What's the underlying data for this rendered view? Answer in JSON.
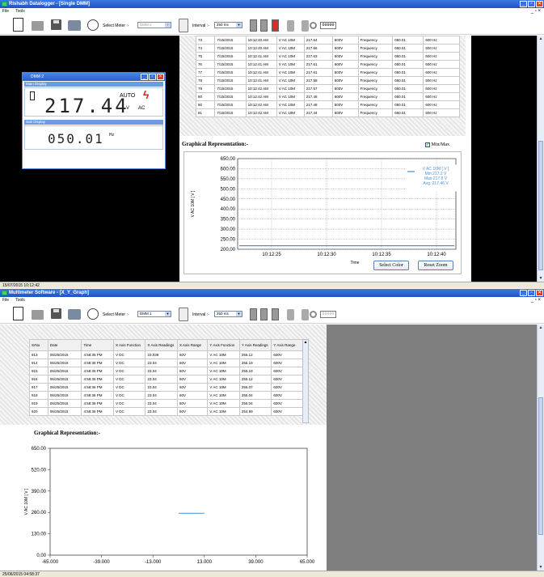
{
  "top": {
    "title": "Rishabh Datalogger - [Single DMM]",
    "menu": [
      "File",
      "Tools"
    ],
    "toolbar": {
      "select_meter_label": "Select Meter :-",
      "meter_value": "DMM 2",
      "interval_label": "Interval :-",
      "interval_value": "250 ms",
      "counter": "60000"
    },
    "table": {
      "rows": [
        [
          "73",
          "7/15/2015",
          "10:12:40 AM",
          "V AC 10M",
          "217.64",
          "600V",
          "Frequency",
          "050.01",
          "600 Hz"
        ],
        [
          "74",
          "7/15/2015",
          "10:12:40 AM",
          "V AC 10M",
          "217.66",
          "600V",
          "Frequency",
          "050.01",
          "600 Hz"
        ],
        [
          "75",
          "7/15/2015",
          "10:12:41 AM",
          "V AC 10M",
          "217.63",
          "600V",
          "Frequency",
          "050.01",
          "600 Hz"
        ],
        [
          "76",
          "7/15/2015",
          "10:12:41 AM",
          "V AC 10M",
          "217.61",
          "600V",
          "Frequency",
          "050.01",
          "600 Hz"
        ],
        [
          "77",
          "7/15/2015",
          "10:12:41 AM",
          "V AC 10M",
          "217.61",
          "600V",
          "Frequency",
          "050.01",
          "600 Hz"
        ],
        [
          "78",
          "7/15/2015",
          "10:12:41 AM",
          "V AC 10M",
          "217.58",
          "600V",
          "Frequency",
          "050.01",
          "600 Hz"
        ],
        [
          "79",
          "7/15/2015",
          "10:12:42 AM",
          "V AC 10M",
          "217.57",
          "600V",
          "Frequency",
          "050.01",
          "600 Hz"
        ],
        [
          "80",
          "7/15/2015",
          "10:12:42 AM",
          "V AC 10M",
          "217.48",
          "600V",
          "Frequency",
          "050.01",
          "600 Hz"
        ],
        [
          "80",
          "7/15/2015",
          "10:12:42 AM",
          "V AC 10M",
          "217.48",
          "600V",
          "Frequency",
          "050.01",
          "600 Hz"
        ],
        [
          "81",
          "7/15/2015",
          "10:12:42 AM",
          "V AC 10M",
          "217.44",
          "600V",
          "Frequency",
          "050.01",
          "600 Hz"
        ]
      ]
    },
    "graph_title": "Graphical Representation:-",
    "minmax_label": "Min/Max",
    "select_color": "Select Color",
    "reset_zoom": "Reset Zoom",
    "status": "15/07/2015 10:12:42",
    "dmm": {
      "title": "DMM 2",
      "main_label": "Main Display",
      "auto": "AUTO",
      "main_value": "217.44",
      "main_unit": "V",
      "main_mode": "AC",
      "sub_label": "Sub Display",
      "sub_value": "050.01",
      "sub_unit": "Hz"
    }
  },
  "bottom": {
    "title": "Multimeter Software - [X_Y_Graph]",
    "menu": [
      "File",
      "Tools"
    ],
    "toolbar": {
      "select_meter_label": "Select Meter :-",
      "meter_value": "DMM 1",
      "interval_label": "Interval :-",
      "interval_value": "250 ms",
      "counter": "60000"
    },
    "table": {
      "headers": [
        "SrNo",
        "Date",
        "Time",
        "X Axis Function",
        "X Axis Readings",
        "X Axis Range",
        "Y Axis Function",
        "Y Axis Readings",
        "Y Axis Range"
      ],
      "rows": [
        [
          "913",
          "06/25/2015",
          "4:58:35 PM",
          "V DC",
          "23.039",
          "60V",
          "V AC 10M",
          "255.12",
          "600V"
        ],
        [
          "914",
          "06/25/2015",
          "4:58:35 PM",
          "V DC",
          "23.04",
          "60V",
          "V AC 10M",
          "255.19",
          "600V"
        ],
        [
          "915",
          "06/25/2015",
          "4:58:35 PM",
          "V DC",
          "23.04",
          "60V",
          "V AC 10M",
          "255.19",
          "600V"
        ],
        [
          "916",
          "06/25/2015",
          "4:58:35 PM",
          "V DC",
          "23.04",
          "60V",
          "V AC 10M",
          "255.12",
          "600V"
        ],
        [
          "917",
          "06/25/2015",
          "4:58:36 PM",
          "V DC",
          "23.04",
          "60V",
          "V AC 10M",
          "255.07",
          "600V"
        ],
        [
          "918",
          "06/25/2015",
          "4:58:36 PM",
          "V DC",
          "23.04",
          "60V",
          "V AC 10M",
          "255.04",
          "600V"
        ],
        [
          "919",
          "06/25/2015",
          "4:58:36 PM",
          "V DC",
          "23.04",
          "60V",
          "V AC 10M",
          "255.04",
          "600V"
        ],
        [
          "920",
          "06/25/2015",
          "4:58:36 PM",
          "V DC",
          "23.04",
          "60V",
          "V AC 10M",
          "254.99",
          "600V"
        ]
      ]
    },
    "graph_title": "Graphical Representation:-",
    "status": "25/06/2015 04:58:37"
  },
  "chart_data": [
    {
      "type": "line",
      "ylabel": "V AC 10M [ V ]",
      "xlabel": "Time",
      "ylim": [
        200,
        650
      ],
      "yticks": [
        "650.00",
        "600.00",
        "550.00",
        "500.00",
        "450.00",
        "400.00",
        "350.00",
        "300.00",
        "250.00",
        "200.00"
      ],
      "xticks": [
        "10:12:25",
        "10:12:30",
        "10:12:35",
        "10:12:40"
      ],
      "series": [
        {
          "name": "V AC 10M [ V ]",
          "values": [
            217.44,
            217.44
          ]
        }
      ],
      "legend": {
        "name": "V AC 10M [ V ]",
        "min": "Min:217.2 V",
        "max": "Max:217.8 V",
        "avg": "Avg.:217.46 V"
      },
      "line_color": "#4a90d9"
    },
    {
      "type": "line",
      "ylabel": "V AC 10M [ V ]",
      "xlabel": "",
      "ylim": [
        0,
        650
      ],
      "xlim": [
        -65,
        65
      ],
      "yticks": [
        "650.00",
        "520.00",
        "390.00",
        "260.00",
        "130.00",
        "0.00"
      ],
      "xticks": [
        "-65.000",
        "-39.000",
        "-13.000",
        "13.000",
        "39.000",
        "65.000"
      ],
      "series": [
        {
          "x": [
            0,
            13
          ],
          "y": [
            255,
            255
          ]
        }
      ],
      "line_color": "#4a90d9"
    }
  ]
}
